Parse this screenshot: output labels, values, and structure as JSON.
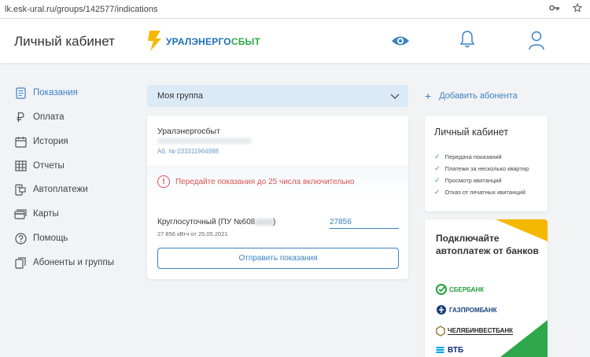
{
  "browser": {
    "url": "lk.esk-ural.ru/groups/142577/indications"
  },
  "header": {
    "title": "Личный кабинет",
    "logo_part1": "УРАЛЭНЕРГО",
    "logo_part2": "СБЫТ"
  },
  "sidebar": {
    "items": [
      {
        "label": "Показания",
        "icon": "meter-icon",
        "active": true
      },
      {
        "label": "Оплата",
        "icon": "ruble-icon"
      },
      {
        "label": "История",
        "icon": "calendar-icon"
      },
      {
        "label": "Отчеты",
        "icon": "grid-icon"
      },
      {
        "label": "Автоплатежи",
        "icon": "autopay-icon"
      },
      {
        "label": "Карты",
        "icon": "card-icon"
      },
      {
        "label": "Помощь",
        "icon": "help-icon"
      },
      {
        "label": "Абоненты и группы",
        "icon": "copy-icon"
      }
    ]
  },
  "group": {
    "selected": "Моя группа"
  },
  "add_subscriber": "Добавить абонента",
  "card": {
    "company": "Уралэнергосбыт",
    "account": "Аб. № 033311964988",
    "alert": "Передайте показания до 25 числа включительно",
    "meter_label": "Круглосуточный (ПУ №608",
    "meter_label_close": ")",
    "meter_sub": "27 856 кВтч от 25.05.2021",
    "reading_value": "27856",
    "send_button": "Отправить показания"
  },
  "info": {
    "title": "Личный кабинет",
    "items": [
      "Передача показаний",
      "Платежи за несколько квартир",
      "Просмотр квитанций",
      "Отказ от печатных квитанций"
    ]
  },
  "banks": {
    "title": "Подключайте автоплатеж от банков",
    "list": [
      "СБЕРБАНК",
      "ГАЗПРОМБАНК",
      "ЧЕЛЯБИНВЕСТБАНК",
      "ВТБ"
    ]
  },
  "colors": {
    "accent": "#3a82c4",
    "alert": "#d9534f",
    "check": "#2ea84a",
    "logo_yellow": "#f5b800",
    "select_bg": "#dbeaf7"
  }
}
